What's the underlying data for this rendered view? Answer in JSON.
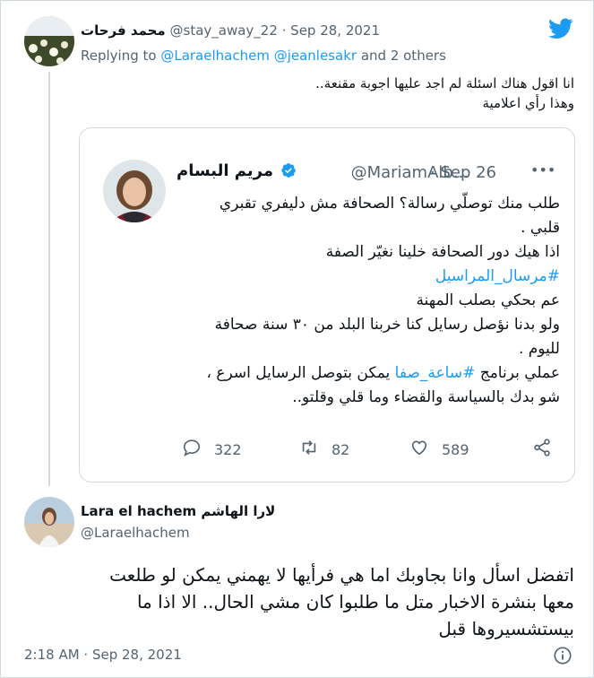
{
  "reply_tweet": {
    "author_name": "محمد فرحات",
    "handle_date": "@stay_away_22 · Sep 28, 2021",
    "replying_to_prefix": "Replying to ",
    "replying_to_users": "@Laraelhachem @jeanlesakr",
    "replying_to_suffix": " and 2 others",
    "text_line1": "انا اقول هناك اسئلة لم اجد عليها اجوبة مقنعة..",
    "text_line2": "وهذا رأي اعلامية",
    "logo_icon": "twitter-bird-icon",
    "brand_color": "#1d9bf0"
  },
  "quoted_tweet": {
    "author_name": "مريم البسام",
    "handle": "@MariamAlb...",
    "date": "· Sep 26",
    "more_label": "•••",
    "lines": [
      "طلب منك توصلّي رسالة؟ الصحافة مش دليفري تقبري",
      "قلبي .",
      "اذا هيك دور الصحافة خلينا نغيّر الصفة",
      "#مرسال_المراسيل",
      "عم بحكي بصلب المهنة",
      "ولو بدنا نؤصل رسايل كنا خربنا البلد من ٣٠ سنة صحافة",
      "لليوم .",
      "شو بدك بالسياسة والقضاء وما قلي وقلتو.."
    ],
    "line9_before": "عملي برنامج ",
    "line9_hashtag": "#ساعة_صفا",
    "line9_after": " يمكن بتوصل الرسايل اسرع ،",
    "replies": "322",
    "retweets": "82",
    "likes": "589"
  },
  "main_tweet": {
    "author_name": "Lara el hachem لارا الهاشم",
    "handle": "@Laraelhachem",
    "text_line1": "اتفضل اسأل وانا بجاوبك اما هي فرأيها لا يهمني يمكن لو طلعت",
    "text_line2": "معها بنشرة الاخبار متل ما طلبوا كان مشي الحال.. الا اذا ما",
    "text_line3": "بيستشسيروها قبل",
    "timestamp": "2:18 AM · Sep 28, 2021",
    "info_icon": "info-icon"
  }
}
